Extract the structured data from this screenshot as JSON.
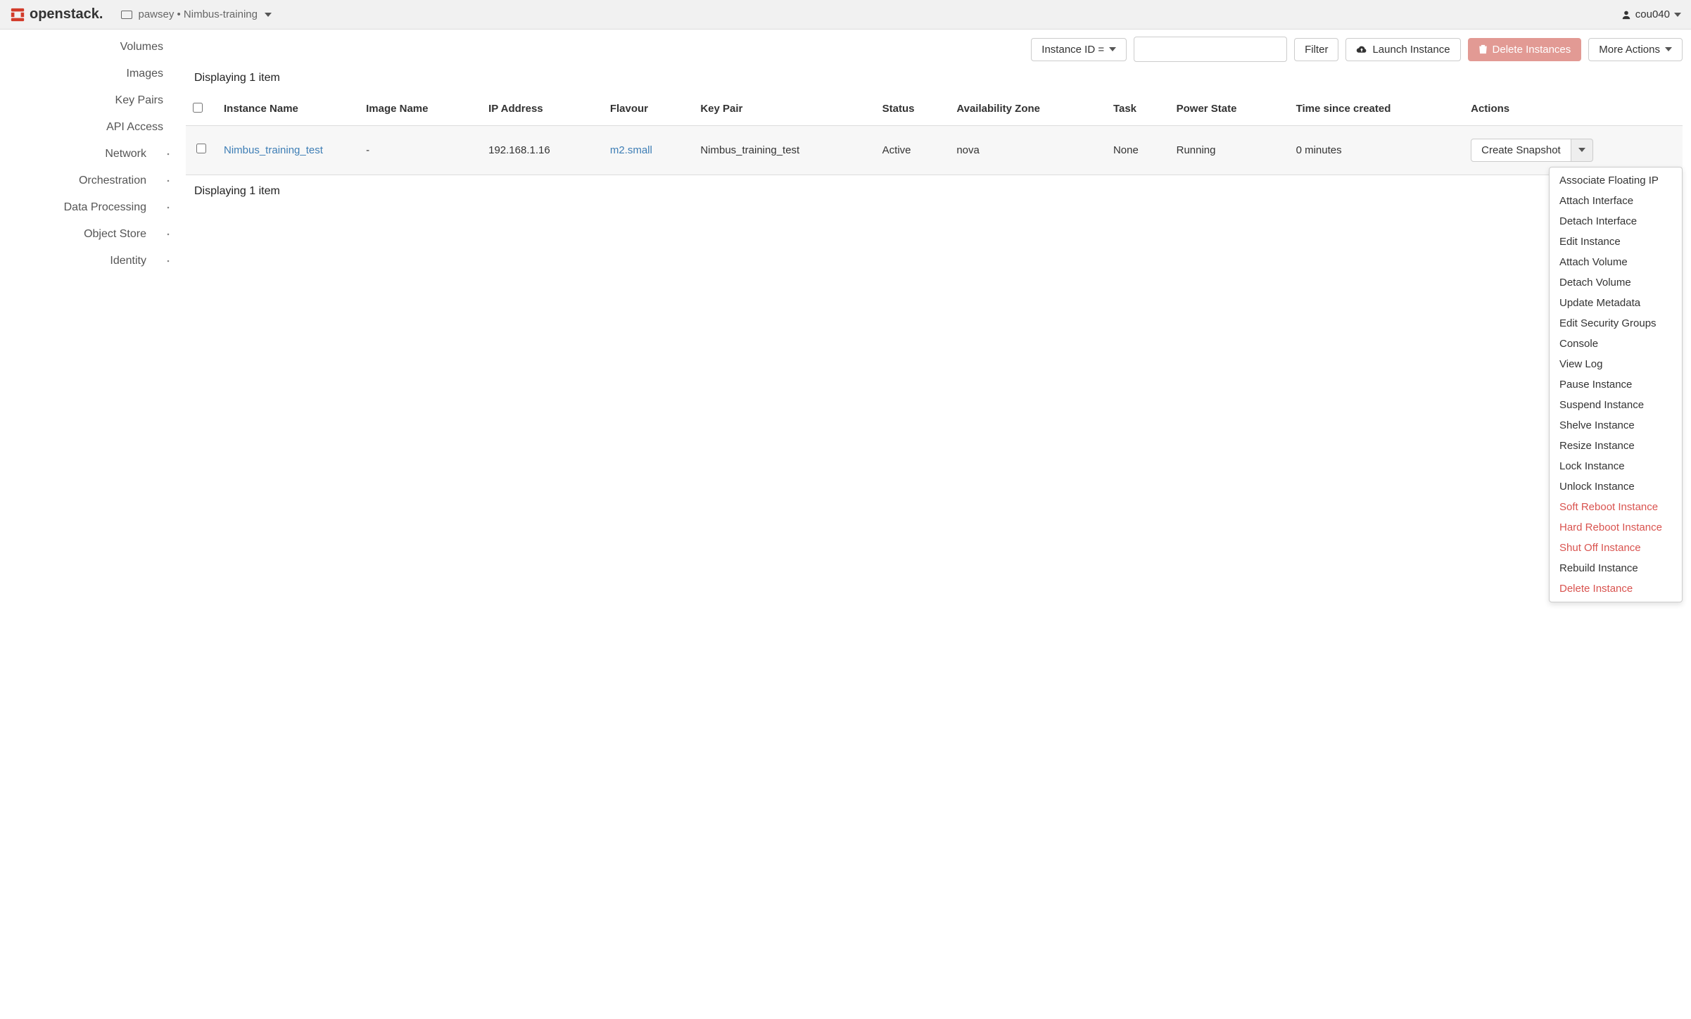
{
  "brand": {
    "name": "openstack."
  },
  "project": {
    "label": "pawsey • Nimbus-training"
  },
  "user": {
    "name": "cou040"
  },
  "sidebar": {
    "items": [
      {
        "label": "Volumes",
        "chevron": false
      },
      {
        "label": "Images",
        "chevron": false
      },
      {
        "label": "Key Pairs",
        "chevron": false
      },
      {
        "label": "API Access",
        "chevron": false
      },
      {
        "label": "Network",
        "chevron": true
      },
      {
        "label": "Orchestration",
        "chevron": true
      },
      {
        "label": "Data Processing",
        "chevron": true
      },
      {
        "label": "Object Store",
        "chevron": true
      },
      {
        "label": "Identity",
        "chevron": true
      }
    ]
  },
  "toolbar": {
    "filter_type": "Instance ID =",
    "filter_btn": "Filter",
    "launch": "Launch Instance",
    "delete": "Delete Instances",
    "more": "More Actions"
  },
  "table": {
    "display_top": "Displaying 1 item",
    "display_bottom": "Displaying 1 item",
    "headers": {
      "instance_name": "Instance Name",
      "image_name": "Image Name",
      "ip": "IP Address",
      "flavour": "Flavour",
      "keypair": "Key Pair",
      "status": "Status",
      "az": "Availability Zone",
      "task": "Task",
      "power": "Power State",
      "time": "Time since created",
      "actions": "Actions"
    },
    "rows": [
      {
        "instance_name": "Nimbus_training_test",
        "image_name": "-",
        "ip": "192.168.1.16",
        "flavour": "m2.small",
        "keypair": "Nimbus_training_test",
        "status": "Active",
        "az": "nova",
        "task": "None",
        "power": "Running",
        "time": "0 minutes",
        "action_btn": "Create Snapshot"
      }
    ]
  },
  "dropdown": {
    "items": [
      {
        "label": "Associate Floating IP",
        "danger": false
      },
      {
        "label": "Attach Interface",
        "danger": false
      },
      {
        "label": "Detach Interface",
        "danger": false
      },
      {
        "label": "Edit Instance",
        "danger": false
      },
      {
        "label": "Attach Volume",
        "danger": false
      },
      {
        "label": "Detach Volume",
        "danger": false
      },
      {
        "label": "Update Metadata",
        "danger": false
      },
      {
        "label": "Edit Security Groups",
        "danger": false
      },
      {
        "label": "Console",
        "danger": false
      },
      {
        "label": "View Log",
        "danger": false
      },
      {
        "label": "Pause Instance",
        "danger": false
      },
      {
        "label": "Suspend Instance",
        "danger": false
      },
      {
        "label": "Shelve Instance",
        "danger": false
      },
      {
        "label": "Resize Instance",
        "danger": false
      },
      {
        "label": "Lock Instance",
        "danger": false
      },
      {
        "label": "Unlock Instance",
        "danger": false
      },
      {
        "label": "Soft Reboot Instance",
        "danger": true
      },
      {
        "label": "Hard Reboot Instance",
        "danger": true
      },
      {
        "label": "Shut Off Instance",
        "danger": true
      },
      {
        "label": "Rebuild Instance",
        "danger": false
      },
      {
        "label": "Delete Instance",
        "danger": true
      }
    ]
  }
}
